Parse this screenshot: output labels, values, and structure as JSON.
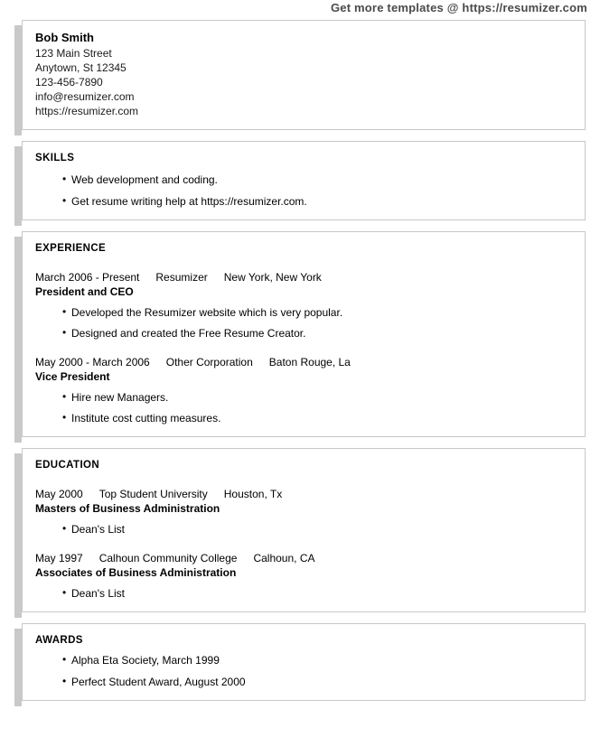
{
  "promo": {
    "text": "Get more templates @ https://resumizer.com"
  },
  "contact": {
    "name": "Bob Smith",
    "address_line1": "123 Main Street",
    "address_line2": "Anytown, St 12345",
    "phone": "123-456-7890",
    "email": "info@resumizer.com",
    "website": "https://resumizer.com"
  },
  "skills": {
    "title": "SKILLS",
    "items": [
      "Web development and coding.",
      "Get resume writing help at https://resumizer.com."
    ]
  },
  "experience": {
    "title": "EXPERIENCE",
    "entries": [
      {
        "dates": "March 2006 - Present",
        "organization": "Resumizer",
        "location": "New York, New York",
        "role": "President and CEO",
        "bullets": [
          "Developed the Resumizer website which is very popular.",
          "Designed and created the Free Resume Creator."
        ]
      },
      {
        "dates": "May 2000 - March 2006",
        "organization": "Other Corporation",
        "location": "Baton Rouge, La",
        "role": "Vice President",
        "bullets": [
          "Hire new Managers.",
          "Institute cost cutting measures."
        ]
      }
    ]
  },
  "education": {
    "title": "EDUCATION",
    "entries": [
      {
        "dates": "May 2000",
        "organization": "Top Student University",
        "location": "Houston, Tx",
        "role": "Masters of Business Administration",
        "bullets": [
          "Dean's List"
        ]
      },
      {
        "dates": "May 1997",
        "organization": "Calhoun Community College",
        "location": "Calhoun, CA",
        "role": "Associates of Business Administration",
        "bullets": [
          "Dean's List"
        ]
      }
    ]
  },
  "awards": {
    "title": "AWARDS",
    "items": [
      "Alpha Eta Society, March 1999",
      "Perfect Student Award, August 2000"
    ]
  },
  "colors": {
    "card_border": "#c8c8c8",
    "card_shadow": "#c9c9c9",
    "promo_text": "#4a4a4a",
    "body_text": "#000000"
  }
}
